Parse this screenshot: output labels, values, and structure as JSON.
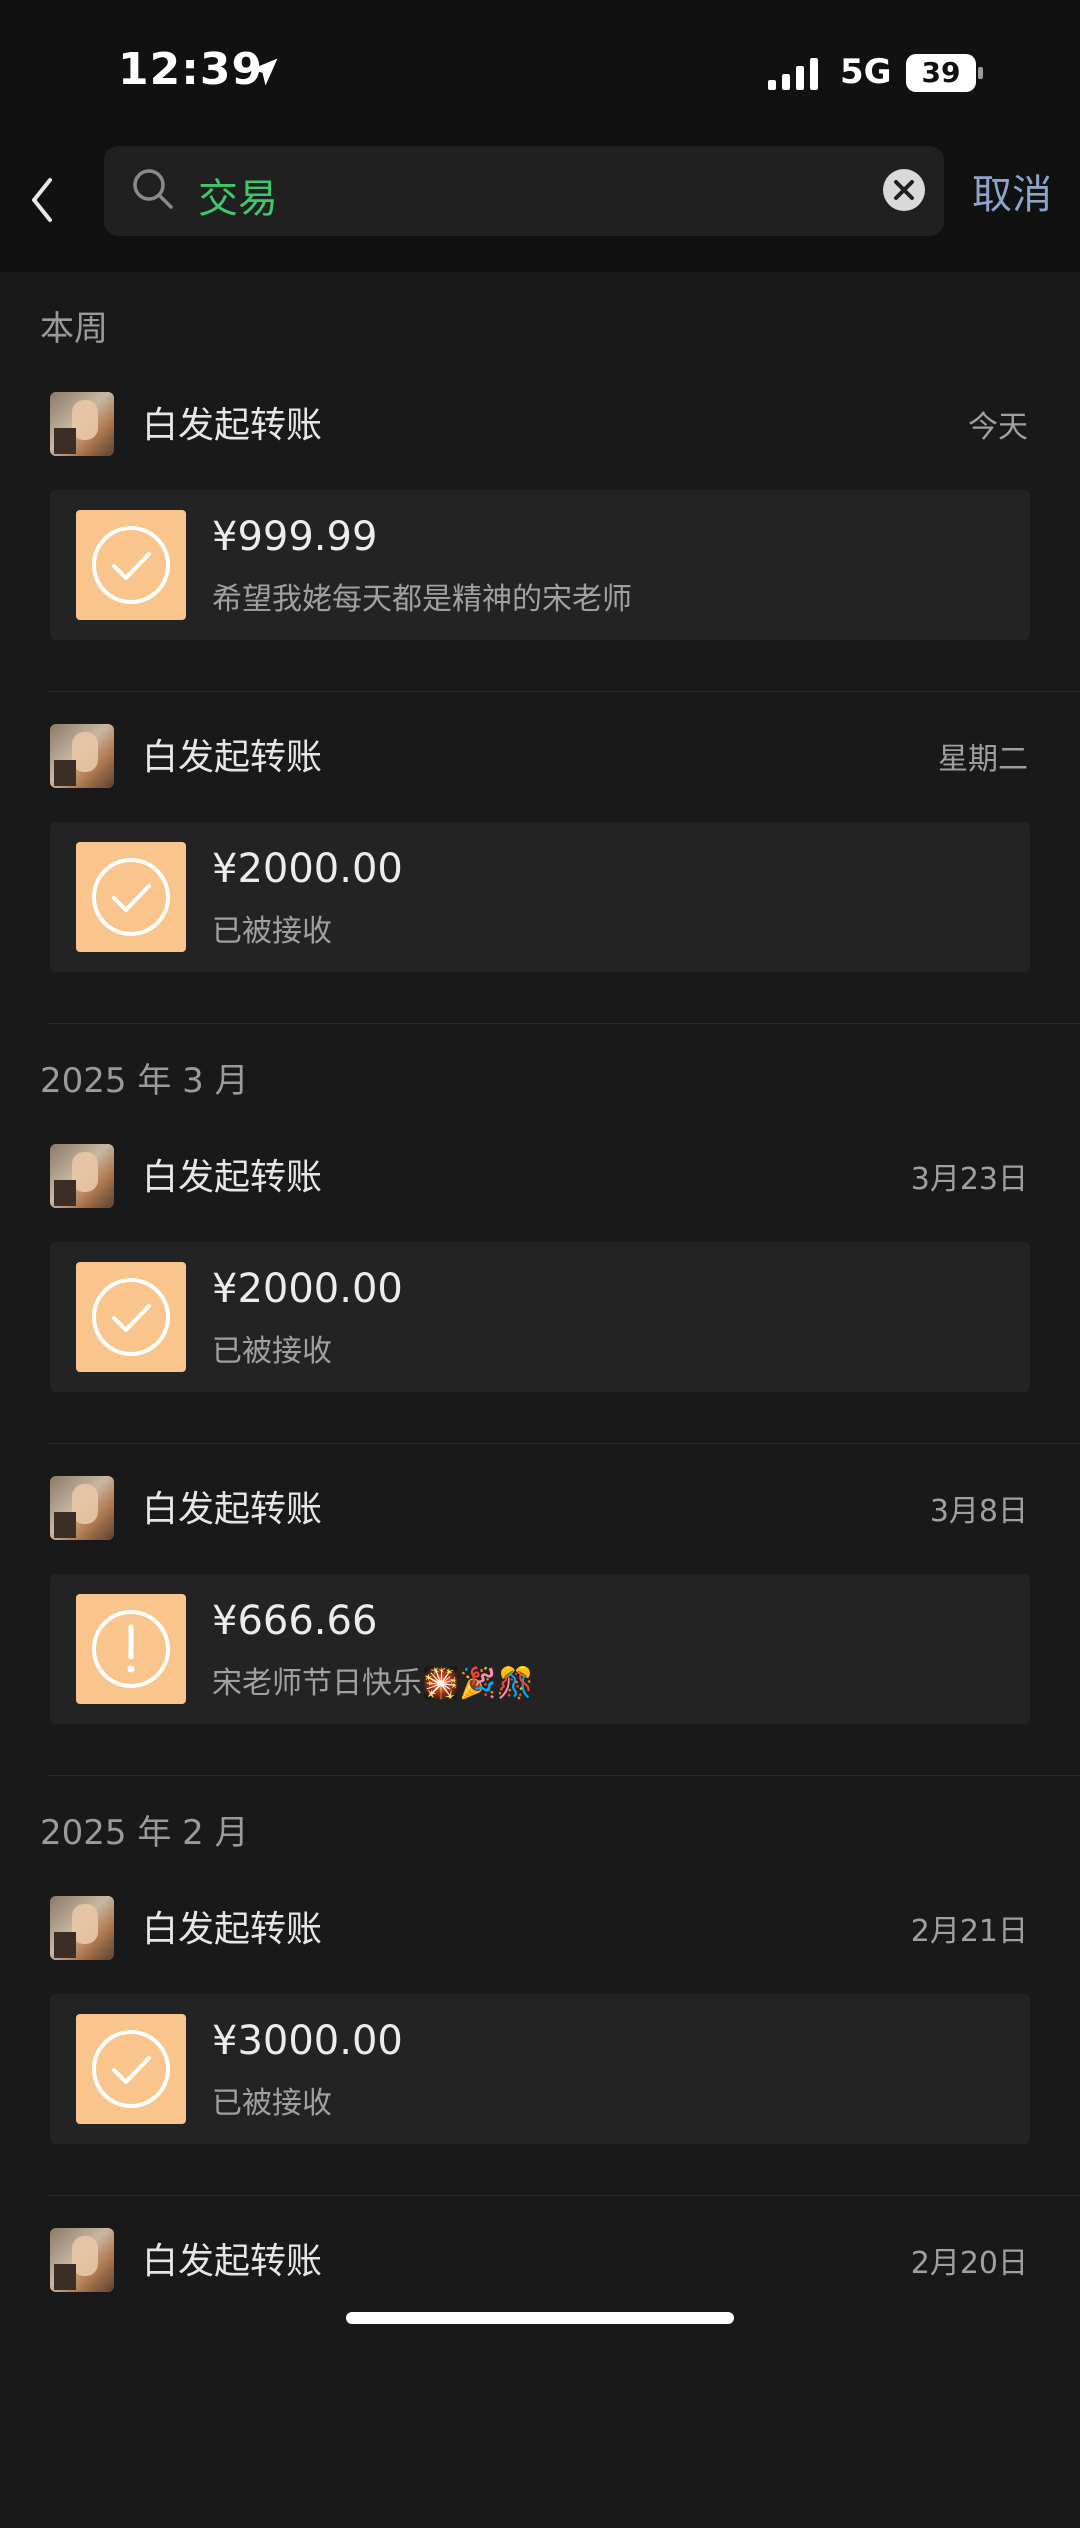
{
  "status_bar": {
    "time": "12:39",
    "network": "5G",
    "battery": "39"
  },
  "search": {
    "query": "交易",
    "cancel_label": "取消"
  },
  "colors": {
    "accent_green": "#3fc76b",
    "icon_bg": "#f9c58c",
    "link_blue": "#8ea3c9"
  },
  "sections": [
    {
      "header": "本周",
      "items": [
        {
          "sender": "白发起转账",
          "date": "今天",
          "amount": "¥999.99",
          "note": "希望我姥每天都是精神的宋老师",
          "icon": "check-circle-icon"
        },
        {
          "sender": "白发起转账",
          "date": "星期二",
          "amount": "¥2000.00",
          "note": "已被接收",
          "icon": "check-circle-icon"
        }
      ]
    },
    {
      "header": "2025 年 3 月",
      "items": [
        {
          "sender": "白发起转账",
          "date": "3月23日",
          "amount": "¥2000.00",
          "note": "已被接收",
          "icon": "check-circle-icon"
        },
        {
          "sender": "白发起转账",
          "date": "3月8日",
          "amount": "¥666.66",
          "note": "宋老师节日快乐🎇🎉🎊",
          "icon": "alert-circle-icon"
        }
      ]
    },
    {
      "header": "2025 年 2 月",
      "items": [
        {
          "sender": "白发起转账",
          "date": "2月21日",
          "amount": "¥3000.00",
          "note": "已被接收",
          "icon": "check-circle-icon"
        },
        {
          "sender": "白发起转账",
          "date": "2月20日",
          "amount": "",
          "note": "",
          "icon": "check-circle-icon"
        }
      ]
    }
  ]
}
